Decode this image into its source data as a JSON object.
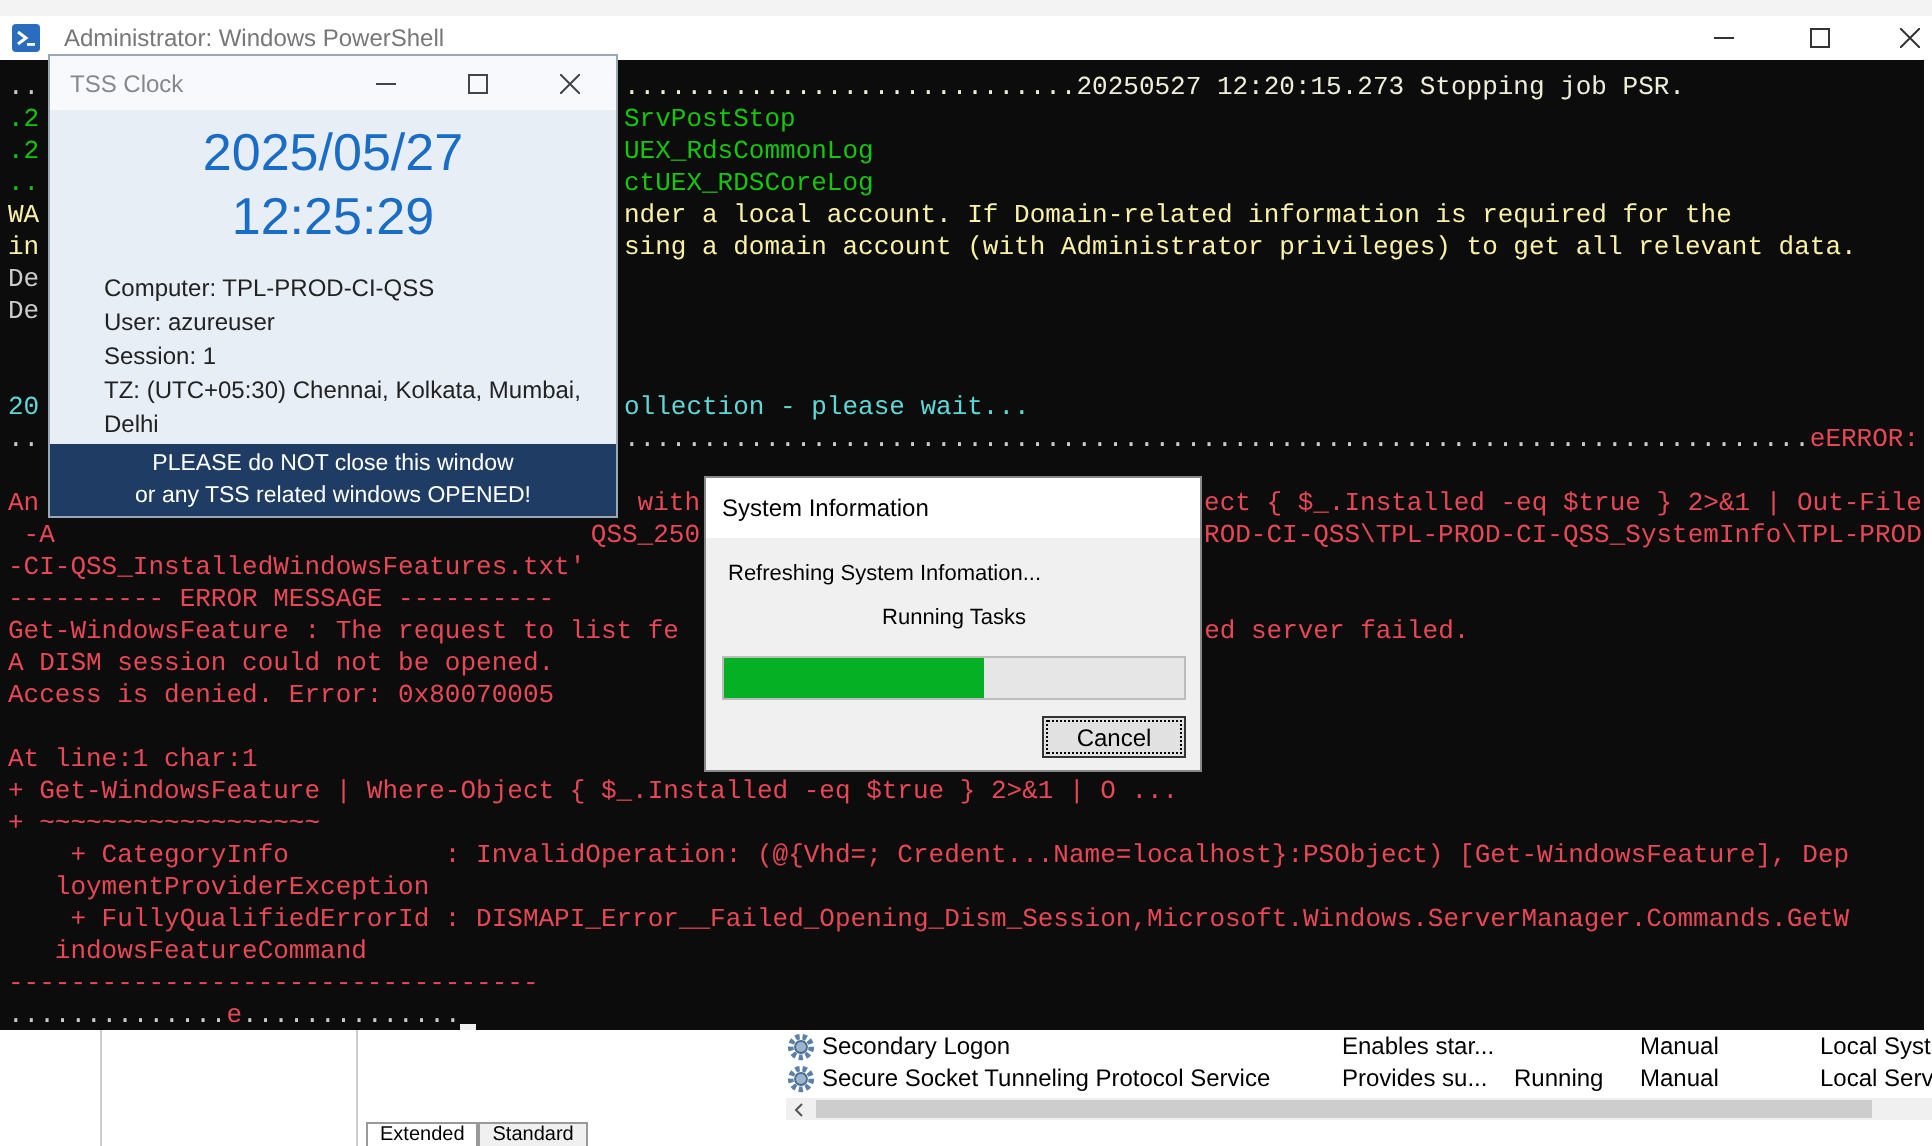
{
  "powershell": {
    "title": "Administrator: Windows PowerShell",
    "lines": [
      {
        "kind": "text",
        "left": [
          {
            "text": "..",
            "color": "#cccccc"
          }
        ],
        "middle": [
          {
            "text": ".............................20250527 12:20:15.273 Stopping job PSR.",
            "color": "#eeeed8"
          }
        ]
      },
      {
        "kind": "text",
        "left": [
          {
            "text": ".2",
            "color": "#16c60c"
          }
        ],
        "middle": [
          {
            "text": "SrvPostStop",
            "color": "#16c60c"
          }
        ]
      },
      {
        "kind": "text",
        "left": [
          {
            "text": ".2",
            "color": "#16c60c"
          }
        ],
        "middle": [
          {
            "text": "UEX_RdsCommonLog",
            "color": "#16c60c"
          }
        ]
      },
      {
        "kind": "text",
        "left": [
          {
            "text": "..",
            "color": "#16c60c"
          }
        ],
        "middle": [
          {
            "text": "ctUEX_RDSCoreLog",
            "color": "#16c60c"
          }
        ]
      },
      {
        "kind": "text",
        "left": [
          {
            "text": "WA",
            "color": "#f9f1a5"
          }
        ],
        "middle": [
          {
            "text": "nder a local account. If Domain-related information is required for the",
            "color": "#f9f1a5"
          }
        ]
      },
      {
        "kind": "text",
        "left": [
          {
            "text": "in",
            "color": "#f9f1a5"
          }
        ],
        "middle": [
          {
            "text": "sing a domain account (with Administrator privileges) to get all relevant data.",
            "color": "#f9f1a5"
          }
        ]
      },
      {
        "kind": "text",
        "left": [
          {
            "text": "De",
            "color": "#cccccc"
          }
        ]
      },
      {
        "kind": "text",
        "left": [
          {
            "text": "De",
            "color": "#cccccc"
          }
        ]
      },
      {
        "kind": "blank"
      },
      {
        "kind": "blank"
      },
      {
        "kind": "text",
        "left": [
          {
            "text": "20",
            "color": "#61d6d6"
          }
        ],
        "middle": [
          {
            "text": "ollection - please wait...",
            "color": "#61d6d6"
          }
        ]
      },
      {
        "kind": "text",
        "left": [
          {
            "text": "..",
            "color": "#cccccc"
          }
        ],
        "middle": [
          {
            "text": "............................................................................",
            "color": "#cccccc"
          },
          {
            "text": "eERROR:",
            "color": "#e74856"
          }
        ]
      },
      {
        "kind": "blank"
      },
      {
        "kind": "text",
        "left": [
          {
            "text": "An",
            "color": "#e74856"
          }
        ],
        "middle": [
          {
            "text": " with",
            "color": "#e74856"
          }
        ],
        "right": [
          {
            "text": "ect { $_.Installed -eq $true } 2>&1 | Out-File",
            "color": "#e74856"
          }
        ]
      },
      {
        "kind": "text",
        "left": [
          {
            "text": " -A",
            "color": "#e74856"
          }
        ],
        "middle": [
          {
            "text": "QSS_250",
            "color": "#e74856"
          }
        ],
        "right": [
          {
            "text": "ROD-CI-QSS\\TPL-PROD-CI-QSS_SystemInfo\\TPL-PROD",
            "color": "#e74856"
          }
        ]
      },
      {
        "kind": "text",
        "left": [
          {
            "text": "-CI-QSS_InstalledWindowsFeatures.txt'",
            "color": "#e74856"
          }
        ]
      },
      {
        "kind": "text",
        "left": [
          {
            "text": "---------- ERROR MESSAGE ----------",
            "color": "#e74856"
          }
        ]
      },
      {
        "kind": "text",
        "left": [
          {
            "text": "Get-WindowsFeature : The request to list fe",
            "color": "#e74856"
          }
        ],
        "right": [
          {
            "text": "ed server failed.",
            "color": "#e74856"
          }
        ]
      },
      {
        "kind": "text",
        "left": [
          {
            "text": "A DISM session could not be opened.",
            "color": "#e74856"
          }
        ]
      },
      {
        "kind": "text",
        "left": [
          {
            "text": "Access is denied. Error: 0x80070005",
            "color": "#e74856"
          }
        ]
      },
      {
        "kind": "blank"
      },
      {
        "kind": "text",
        "left": [
          {
            "text": "At line:1 char:1",
            "color": "#e74856"
          }
        ]
      },
      {
        "kind": "text",
        "left": [
          {
            "text": "+ Get-WindowsFeature | Where-Object { $_.Installed -eq $true } 2>&1 | O ...",
            "color": "#e74856"
          }
        ]
      },
      {
        "kind": "text",
        "left": [
          {
            "text": "+ ~~~~~~~~~~~~~~~~~~",
            "color": "#e74856"
          }
        ]
      },
      {
        "kind": "text",
        "left": [
          {
            "text": "    + CategoryInfo          : InvalidOperation: (@{Vhd=; Credent...Name=localhost}:PSObject) [Get-WindowsFeature], Dep",
            "color": "#e74856"
          }
        ]
      },
      {
        "kind": "text",
        "left": [
          {
            "text": "   loymentProviderException",
            "color": "#e74856"
          }
        ]
      },
      {
        "kind": "text",
        "left": [
          {
            "text": "    + FullyQualifiedErrorId : DISMAPI_Error__Failed_Opening_Dism_Session,Microsoft.Windows.ServerManager.Commands.GetW",
            "color": "#e74856"
          }
        ]
      },
      {
        "kind": "text",
        "left": [
          {
            "text": "   indowsFeatureCommand",
            "color": "#e74856"
          }
        ]
      },
      {
        "kind": "text",
        "left": [
          {
            "text": "----------------------------------",
            "color": "#e74856"
          }
        ]
      },
      {
        "kind": "text",
        "cursor": true,
        "left": [
          {
            "text": "..............",
            "color": "#cccccc"
          },
          {
            "text": "e",
            "color": "#e74856"
          },
          {
            "text": "..............",
            "color": "#cccccc"
          }
        ]
      }
    ]
  },
  "tss_clock": {
    "title": "TSS Clock",
    "date": "2025/05/27",
    "time": "12:25:29",
    "info": [
      "Computer: TPL-PROD-CI-QSS",
      "User: azureuser",
      "Session: 1",
      "TZ: (UTC+05:30) Chennai, Kolkata, Mumbai,",
      "Delhi"
    ],
    "warning": [
      "PLEASE do NOT close this window",
      "or any TSS related windows OPENED!"
    ]
  },
  "dialog": {
    "title": "System Information",
    "status": "Refreshing System Infomation...",
    "task": "Running Tasks",
    "progress": {
      "level": 0.565
    },
    "button": "Cancel"
  },
  "services": {
    "rows": [
      {
        "name": "Secondary Logon",
        "description": "Enables star...",
        "startup": "Manual",
        "logon": "Local Syst"
      },
      {
        "name": "Secure Socket Tunneling Protocol Service",
        "description": "Provides su...",
        "status": "Running",
        "startup": "Manual",
        "logon": "Local Serv"
      }
    ],
    "tabs": [
      {
        "label": "Extended",
        "selected": true
      },
      {
        "label": "Standard",
        "selected": false
      }
    ]
  }
}
